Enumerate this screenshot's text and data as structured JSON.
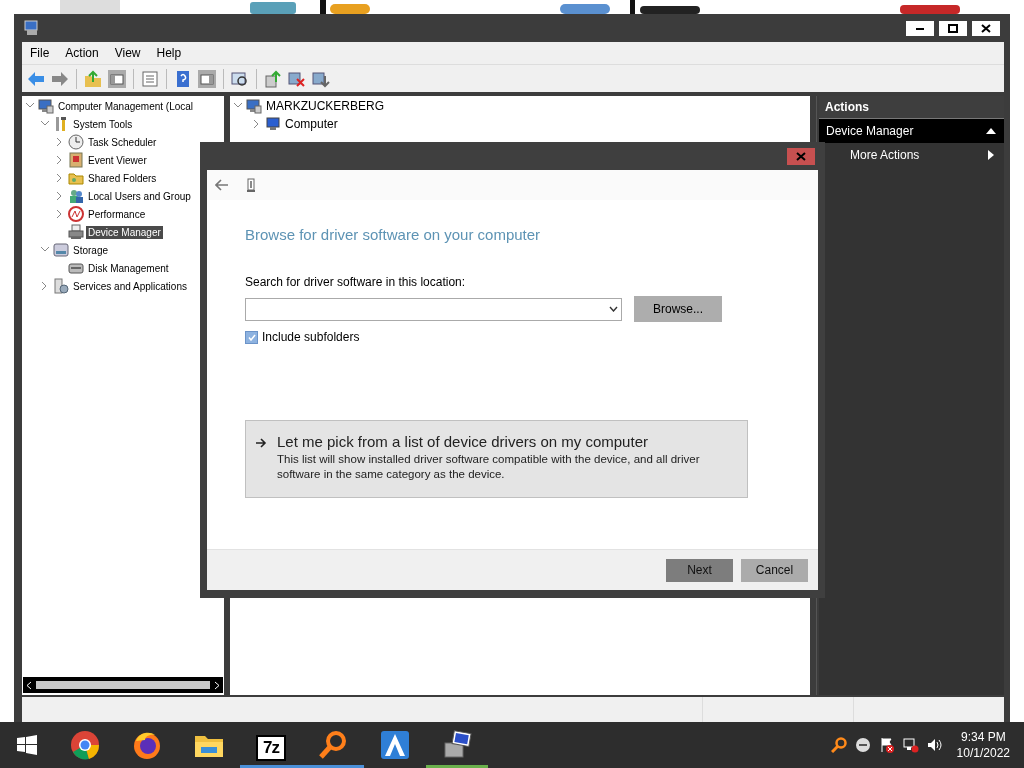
{
  "window": {
    "menu": [
      "File",
      "Action",
      "View",
      "Help"
    ]
  },
  "tree": [
    {
      "label": "Computer Management (Local",
      "kind": "computer",
      "expanded": true,
      "selected": false,
      "children": [
        {
          "label": "System Tools",
          "kind": "tools",
          "expanded": true,
          "selected": false,
          "children": [
            {
              "label": "Task Scheduler",
              "kind": "clock",
              "expanded": false,
              "selected": false
            },
            {
              "label": "Event Viewer",
              "kind": "log",
              "expanded": false,
              "selected": false
            },
            {
              "label": "Shared Folders",
              "kind": "folder",
              "expanded": false,
              "selected": false
            },
            {
              "label": "Local Users and Group",
              "kind": "users",
              "expanded": false,
              "selected": false
            },
            {
              "label": "Performance",
              "kind": "gauge",
              "expanded": false,
              "selected": false
            },
            {
              "label": "Device Manager",
              "kind": "device",
              "selected": true
            }
          ]
        },
        {
          "label": "Storage",
          "kind": "storage",
          "expanded": true,
          "selected": false,
          "children": [
            {
              "label": "Disk Management",
              "kind": "disk",
              "selected": false
            }
          ]
        },
        {
          "label": "Services and Applications",
          "kind": "services",
          "expanded": false,
          "selected": false
        }
      ]
    }
  ],
  "devices": [
    {
      "label": "MARKZUCKERBERG",
      "kind": "computer",
      "expanded": true,
      "children": [
        {
          "label": "Computer",
          "kind": "monitor",
          "expanded": false
        }
      ]
    }
  ],
  "actions": {
    "title": "Actions",
    "sections": [
      {
        "label": "Device Manager",
        "expanded": true,
        "items": [
          "More Actions"
        ]
      }
    ]
  },
  "dialog": {
    "heading": "Browse for driver software on your computer",
    "field_label": "Search for driver software in this location:",
    "browse": "Browse...",
    "include_subfolders": {
      "label": "Include subfolders",
      "checked": true
    },
    "option": {
      "title": "Let me pick from a list of device drivers on my computer",
      "description": "This list will show installed driver software compatible with the device, and all driver software in the same category as the device."
    },
    "buttons": [
      {
        "label": "Next",
        "default": true
      },
      {
        "label": "Cancel",
        "default": false
      }
    ]
  },
  "taskbar": {
    "apps": [
      {
        "kind": "chrome",
        "running": false
      },
      {
        "kind": "firefox",
        "running": false
      },
      {
        "kind": "folder",
        "running": false
      },
      {
        "kind": "sevenzip",
        "label": "7z",
        "running": true,
        "color": "#4a8fd8"
      },
      {
        "kind": "search",
        "running": true,
        "color": "#4a8fd8"
      },
      {
        "kind": "triangle",
        "running": false
      },
      {
        "kind": "computer",
        "running": true,
        "color": "#6ab04c"
      }
    ],
    "time": "9:34 PM",
    "date": "10/1/2022"
  }
}
